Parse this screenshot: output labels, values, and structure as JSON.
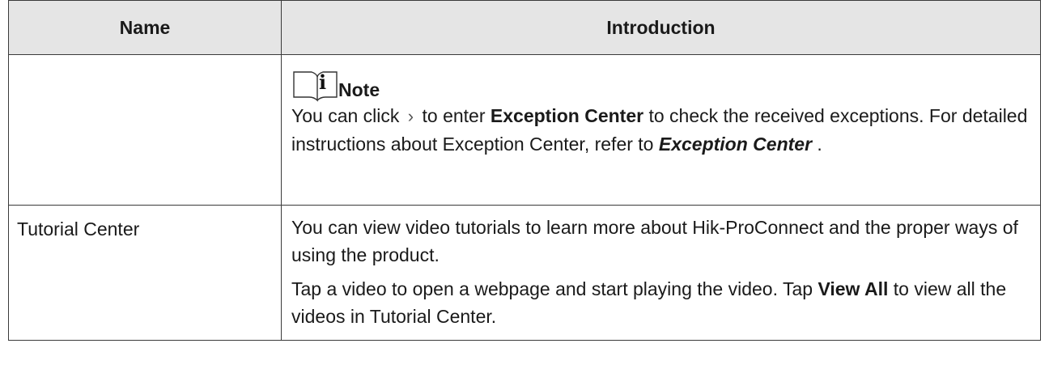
{
  "table": {
    "headers": {
      "name": "Name",
      "introduction": "Introduction"
    },
    "rows": [
      {
        "name": "",
        "note": {
          "icon": "note-book-icon",
          "label": "Note",
          "text_before": "You can click",
          "chevron": "›",
          "text_mid": "to enter",
          "bold_term": "Exception Center",
          "text_after": "to check the received exceptions. For detailed instructions about Exception Center, refer to",
          "xref": "Exception Center",
          "end": "."
        }
      },
      {
        "name": "Tutorial Center",
        "paragraphs": {
          "p1": "You can view video tutorials to learn more about Hik-ProConnect and the proper ways of using the product.",
          "p2_before": "Tap a video to open a webpage and start playing the video. Tap",
          "p2_bold": "View All",
          "p2_after": "to view all the videos in Tutorial Center."
        }
      }
    ]
  }
}
